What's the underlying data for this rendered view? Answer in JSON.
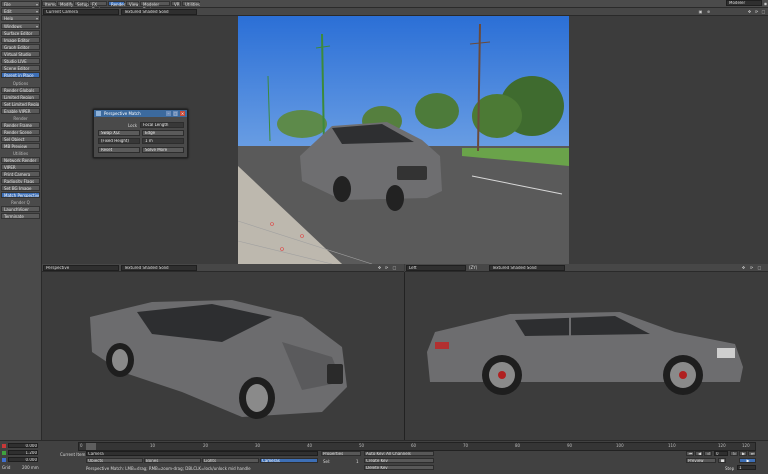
{
  "colors": {
    "accent": "#3d6fb6",
    "panel": "#4a4a4a",
    "viewport": "#3c3c3c"
  },
  "left_panel": {
    "top_buttons": [
      "File",
      "Edit",
      "Help"
    ],
    "windows_head": "Windows",
    "windows_items": [
      "Surface Editor",
      "Image Editor",
      "Graph Editor",
      "Virtual Studio",
      "Studio LIVE",
      "Scene Editor"
    ],
    "parent_in_place": "Parent in Place",
    "options_head": "Options",
    "options_items": [
      "Render Globals",
      "Limited Region",
      "Set Limited Region",
      "Enable VIPER"
    ],
    "render_head": "Render",
    "render_items": [
      "Render Frame",
      "Render Scene",
      "Sel Object",
      "MB Preview"
    ],
    "utilities_head": "Utilities",
    "utilities_items": [
      "Network Render",
      "VIPER",
      "Print Camera",
      "Radiosity Flags",
      "Set BG Image",
      "Match Perspective"
    ],
    "render_q_head": "Render Q",
    "render_q_items": [
      "LaunchViper",
      "Terminate"
    ]
  },
  "menu_tabs": [
    "Items",
    "Modify",
    "Setup",
    "FX Tools",
    "Render",
    "View",
    "Modeler Tools",
    "VR",
    "Utilities"
  ],
  "active_tab": "Render",
  "modeler_dropdown": "Modeler",
  "viewport_top": {
    "view": "Current Camera",
    "shading": "Textured Shaded Solid"
  },
  "viewport_bl": {
    "view": "Perspective",
    "shading": "Textured Shaded Solid"
  },
  "viewport_br": {
    "view": "Left",
    "axis": "(ZY)",
    "shading": "Textured Shaded Solid"
  },
  "dialog": {
    "title": "Perspective Match",
    "lock_label": "Lock",
    "lock_value": "Focal Length",
    "swap_button": "Swap X/Z",
    "edge_button": "Edge",
    "mode_value": "(Fixed Height)",
    "height_value": "1 m",
    "reset_button": "Reset",
    "solve_button": "Solve More"
  },
  "timeline": {
    "ticks": [
      "0",
      "10",
      "20",
      "30",
      "40",
      "50",
      "60",
      "70",
      "80",
      "90",
      "100",
      "110",
      "120"
    ],
    "right_end": "120",
    "position_values": [
      "0.000",
      "1.200",
      "0.000"
    ],
    "grid_label": "Grid",
    "grid_value": "200 mm",
    "current_item_label": "Current Item",
    "current_item": "Camera",
    "item_tabs": [
      "Objects",
      "Bones",
      "Lights",
      "Cameras"
    ],
    "properties_button": "Properties",
    "sel_label": "Sel:",
    "sel_value": "1",
    "auto_key": "Auto Key: All Channels",
    "create_key": "Create Key",
    "delete_key": "Delete Key",
    "status_text": "Perspective Match: LMB=drag; RMB=zoom-drag; DBLCLK=lock/unlock mid handle",
    "preview_label": "Preview",
    "step_label": "Step",
    "step_value": "1",
    "frame_value": "0"
  }
}
